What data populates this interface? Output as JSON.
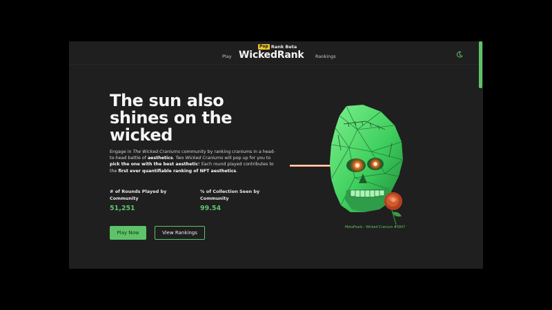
{
  "header": {
    "badge": "Pop",
    "subtitle": "Rank Beta",
    "title": "WickedRank",
    "nav": {
      "play": "Play",
      "rankings": "Rankings"
    },
    "theme_icon": "moon-icon"
  },
  "hero": {
    "title": "The sun also shines on the wicked",
    "description": {
      "p1": "Engage in ",
      "p2": "The Wicked Craniums",
      "p3": " community by ranking craniums in a head-to-head battle of ",
      "p4": "aesthetics",
      "p5": ". Two ",
      "p6": "Wicked Craniums",
      "p7": " will pop up for you to ",
      "p8": "pick the one with the best aesthetic",
      "p9": "! Each round played contributes to the ",
      "p10": "first ever quantifiable ranking of NFT aesthetics",
      "p11": "."
    }
  },
  "stats": [
    {
      "label": "# of Rounds Played by Community",
      "value": "51,251"
    },
    {
      "label": "% of Collection Seen by Community",
      "value": "99.54"
    }
  ],
  "buttons": {
    "play": "Play Now",
    "rankings": "View Rankings"
  },
  "artwork": {
    "caption": "MetaPixels - Wicked Cranium #5847",
    "icon": "skull-illustration"
  },
  "colors": {
    "accent": "#5ec26a",
    "background": "#1f1f1f",
    "page": "#000000",
    "badge": "#f2c230"
  }
}
